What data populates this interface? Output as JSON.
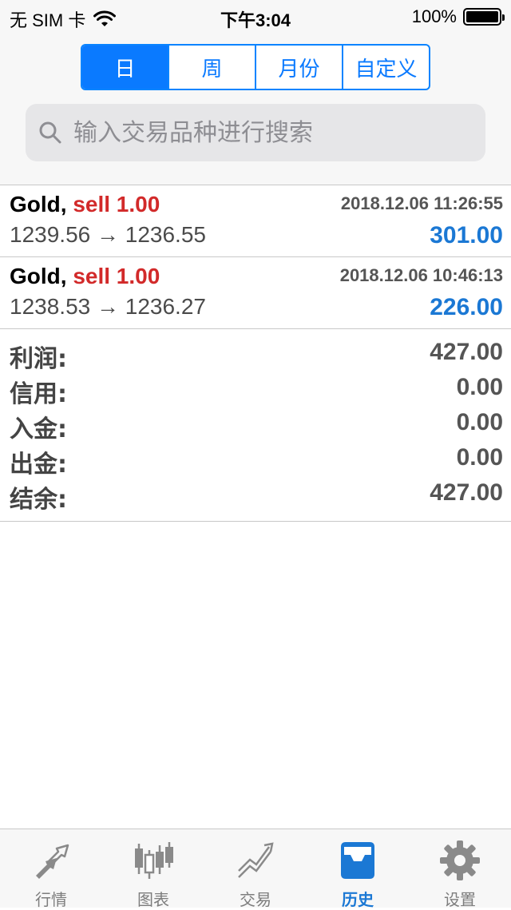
{
  "status_bar": {
    "carrier": "无 SIM 卡",
    "time": "下午3:04",
    "battery": "100%"
  },
  "segments": [
    "日",
    "周",
    "月份",
    "自定义"
  ],
  "active_segment": "日",
  "search": {
    "placeholder": "输入交易品种进行搜索"
  },
  "deals": [
    {
      "symbol": "Gold,",
      "type": "sell 1.00",
      "time": "2018.12.06 11:26:55",
      "prices": "1239.56 → 1236.55",
      "profit": "301.00"
    },
    {
      "symbol": "Gold,",
      "type": "sell 1.00",
      "time": "2018.12.06 10:46:13",
      "prices": "1238.53 → 1236.27",
      "profit": "226.00"
    }
  ],
  "summary": [
    {
      "label": "利润:",
      "value": "427.00"
    },
    {
      "label": "信用:",
      "value": "0.00"
    },
    {
      "label": "入金:",
      "value": "0.00"
    },
    {
      "label": "出金:",
      "value": "0.00"
    },
    {
      "label": "结余:",
      "value": "427.00"
    }
  ],
  "tabs": [
    {
      "label": "行情",
      "icon": "quotes-arrows-icon"
    },
    {
      "label": "图表",
      "icon": "candlestick-chart-icon"
    },
    {
      "label": "交易",
      "icon": "trade-trend-icon"
    },
    {
      "label": "历史",
      "icon": "history-inbox-icon"
    },
    {
      "label": "设置",
      "icon": "gear-icon"
    }
  ],
  "active_tab": "历史",
  "colors": {
    "accent": "#0a7aff",
    "sell": "#d22a2a",
    "profit": "#1b78d4",
    "tab_inactive": "#8a8a8a"
  }
}
